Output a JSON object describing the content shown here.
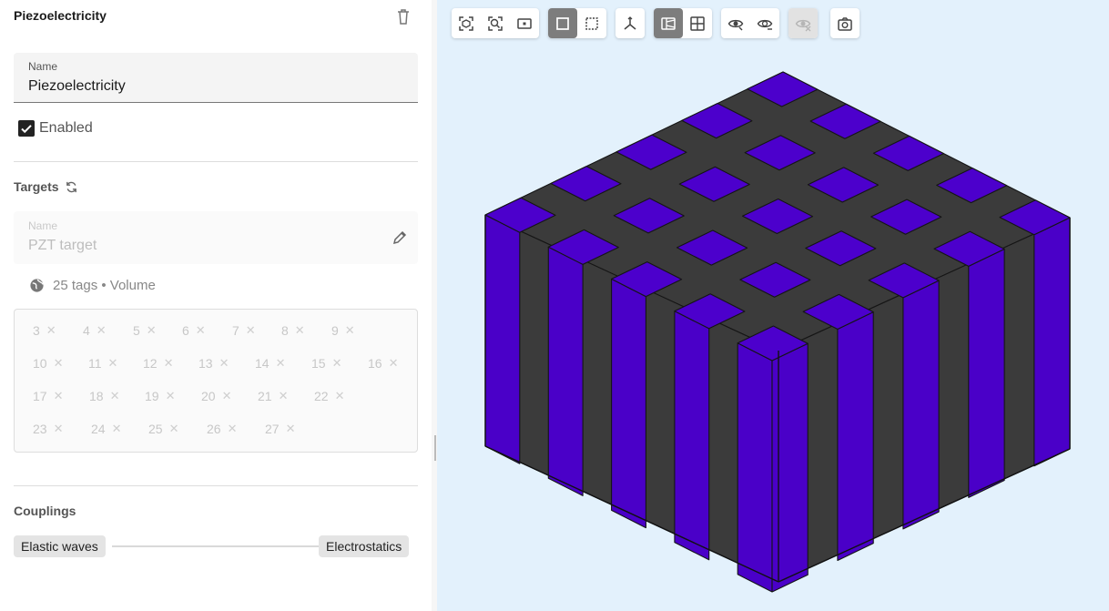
{
  "panel": {
    "title": "Piezoelectricity",
    "name_label": "Name",
    "name_value": "Piezoelectricity",
    "enabled_label": "Enabled",
    "enabled": true
  },
  "targets": {
    "title": "Targets",
    "name_label": "Name",
    "name_placeholder": "PZT target",
    "summary": "25 tags • Volume",
    "tags": [
      "3",
      "4",
      "5",
      "6",
      "7",
      "8",
      "9",
      "10",
      "11",
      "12",
      "13",
      "14",
      "15",
      "16",
      "17",
      "18",
      "19",
      "20",
      "21",
      "22",
      "23",
      "24",
      "25",
      "26",
      "27"
    ]
  },
  "couplings": {
    "title": "Couplings",
    "from": "Elastic waves",
    "to": "Electrostatics"
  },
  "toolbar": {
    "groups": [
      [
        "fit-all-icon",
        "zoom-fit-icon",
        "zoom-window-icon"
      ],
      [
        "solid-view-icon",
        "wireframe-view-icon"
      ],
      [
        "axes-icon"
      ],
      [
        "clip-plane-icon",
        "grid-icon"
      ],
      [
        "show-icon",
        "hide-icon"
      ],
      [
        "show-all-icon"
      ],
      [
        "screenshot-icon"
      ]
    ],
    "active": [
      "solid-view-icon",
      "clip-plane-icon"
    ],
    "disabled": [
      "show-all-icon"
    ]
  },
  "colors": {
    "pillar": "#4a00c8",
    "pillar_top": "#4c00cc",
    "matrix": "#3b3b3b",
    "background": "#e3f1fc"
  }
}
